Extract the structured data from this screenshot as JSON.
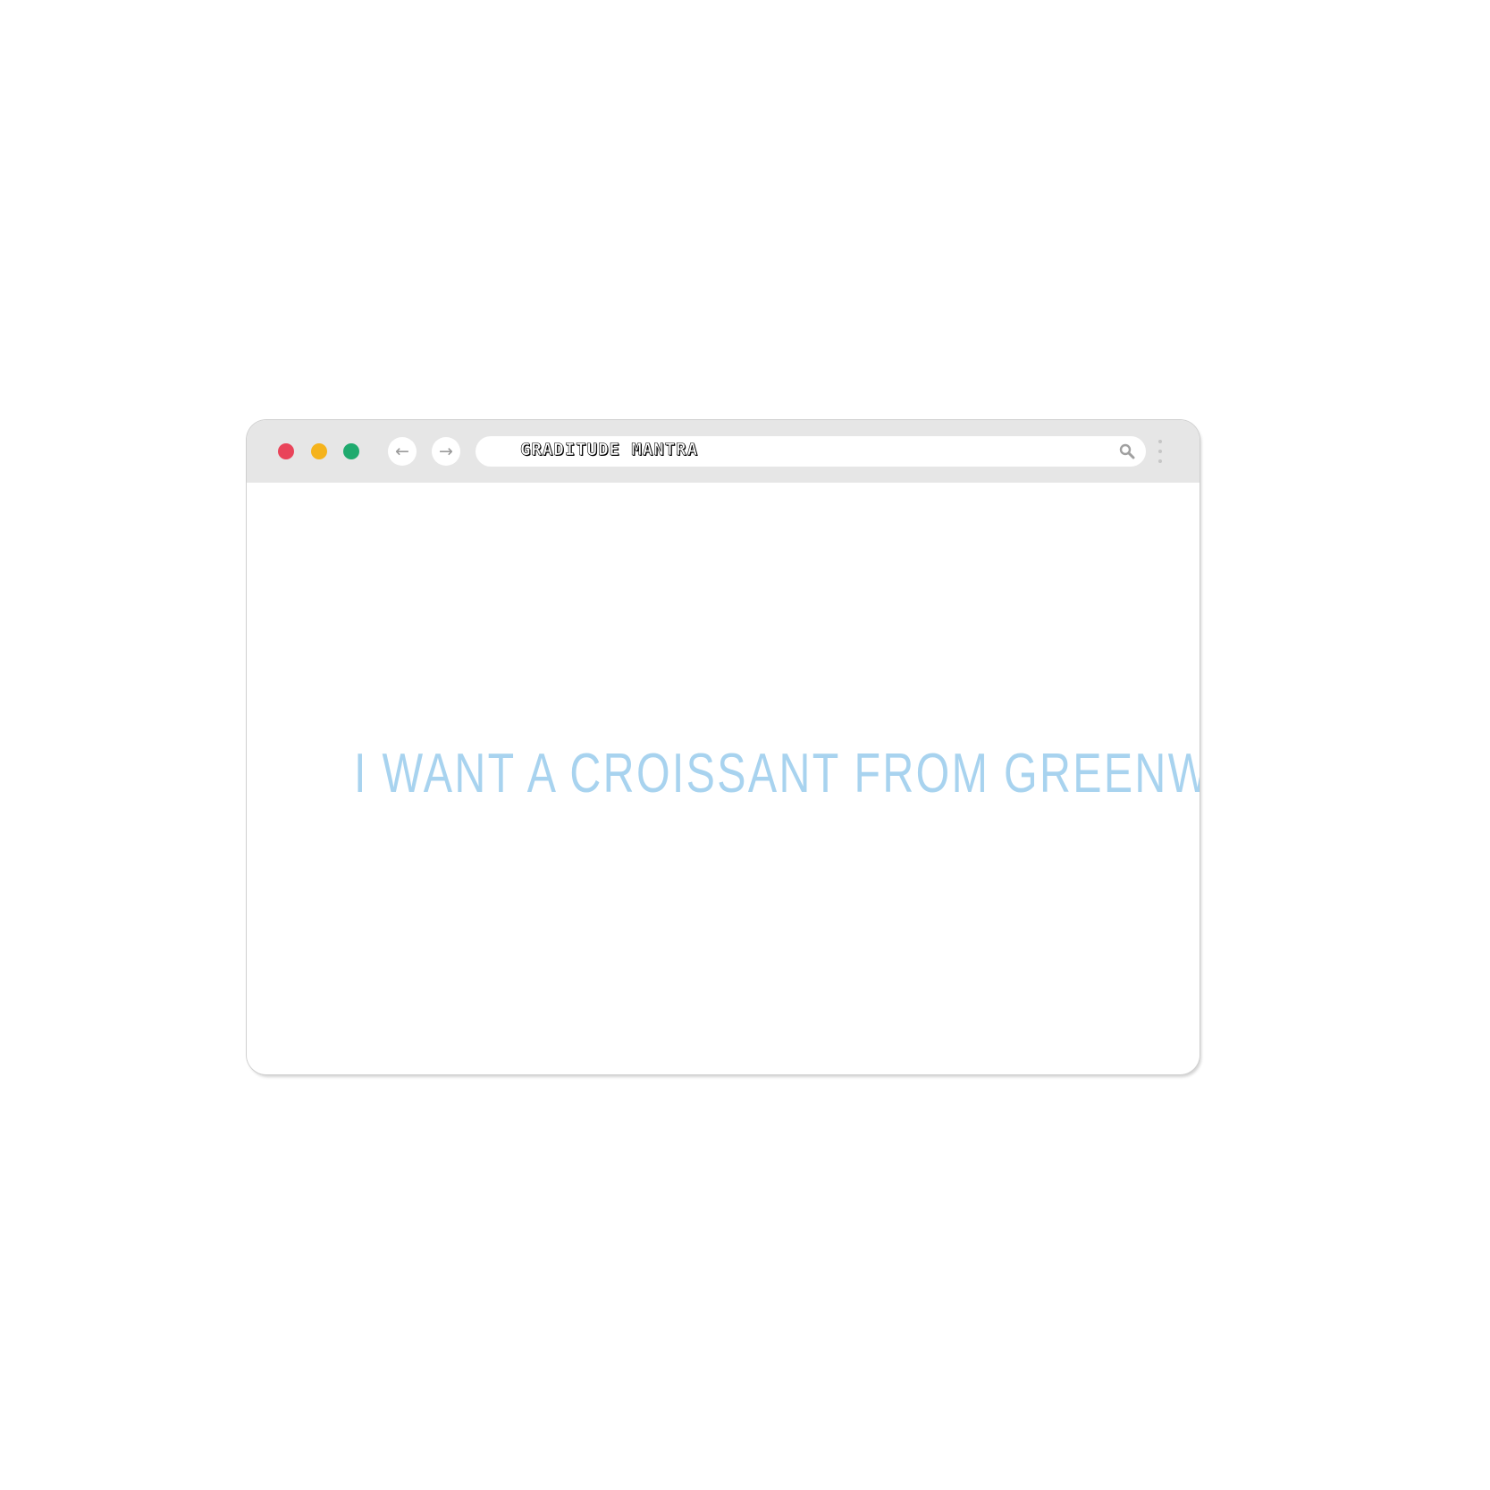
{
  "browser": {
    "traffic_lights": {
      "close_color": "#e9445a",
      "minimize_color": "#f5b31c",
      "maximize_color": "#1faa6e"
    },
    "nav": {
      "back_icon": "arrow-left-icon",
      "forward_icon": "arrow-right-icon",
      "back_glyph": "←",
      "forward_glyph": "→"
    },
    "address_bar": {
      "text": "GRADITUDE MANTRA",
      "icon": "search-icon"
    },
    "menu_icon": "vertical-dots-icon"
  },
  "page": {
    "headline": "I WANT A CROISSANT FROM GREENWICH",
    "headline_color": "#a8d3ef"
  }
}
